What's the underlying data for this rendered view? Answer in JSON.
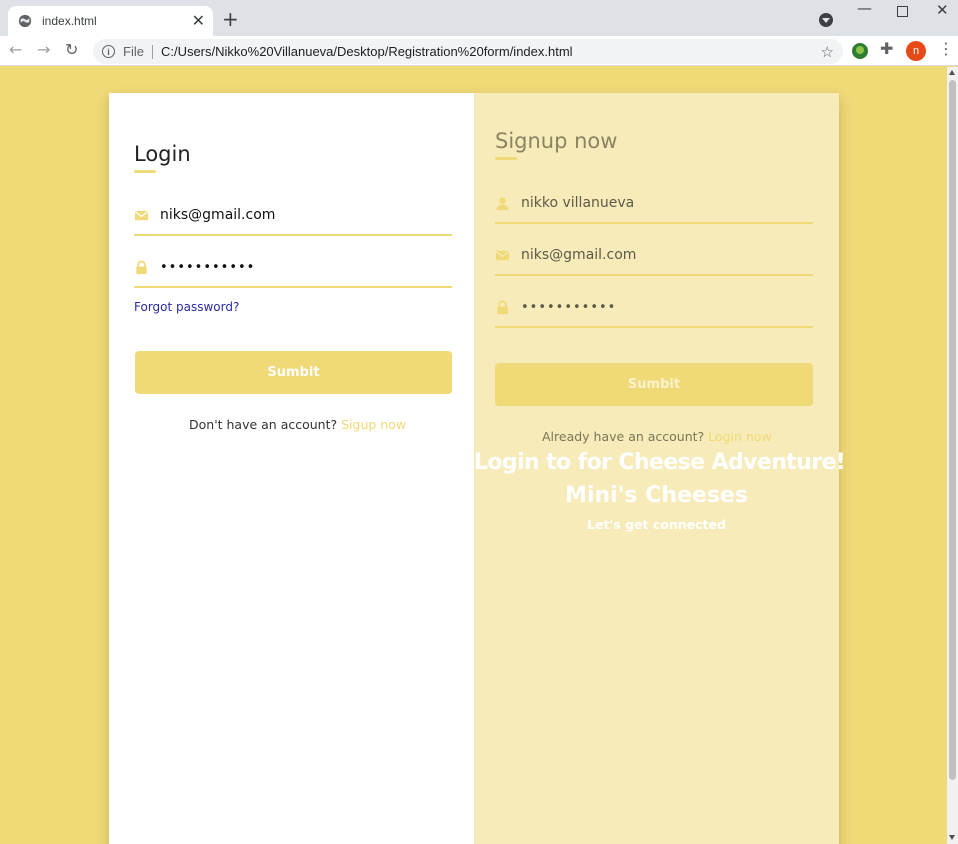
{
  "browser": {
    "tab_title": "index.html",
    "tab_close": "✕",
    "new_tab": "+",
    "omnibox_scheme": "File",
    "url": "C:/Users/Nikko%20Villanueva/Desktop/Registration%20form/index.html",
    "avatar_letter": "n",
    "icons": [
      "globe-icon",
      "back-icon",
      "forward-icon",
      "reload-icon",
      "info-icon",
      "star-icon",
      "extension-icon",
      "puzzle-icon",
      "menu-icon"
    ]
  },
  "login": {
    "title": "Login",
    "email_value": "niks@gmail.com",
    "password_value": "•••••••••••",
    "forgot_label": "Forgot password?",
    "submit_label": "Sumbit",
    "switch_text": "Don't have an account?",
    "switch_link": "Sigup now"
  },
  "signup": {
    "title": "Signup now",
    "name_value": "nikko villanueva",
    "email_value": "niks@gmail.com",
    "password_value": "•••••••••••",
    "submit_label": "Sumbit",
    "switch_text": "Already have an account?",
    "switch_link": "Login now",
    "promo_line1": "Login to for Cheese Adventure!",
    "promo_line2": "Mini's Cheeses",
    "promo_line3": "Let's get connected"
  },
  "colors": {
    "accent": "#f0d977",
    "signup_panel": "#f6ebb9",
    "link": "#2a2aa8"
  }
}
